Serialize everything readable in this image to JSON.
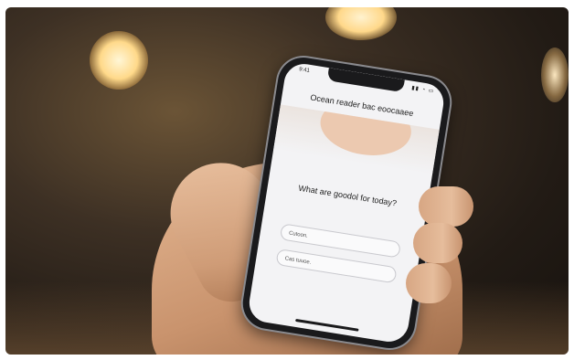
{
  "phone": {
    "status_time": "9:41",
    "status_icons": "▮▮ ◔ ▭",
    "header": "Ocean reader bac eoocaaee",
    "prompt": "What are goodol for today?",
    "fields": [
      {
        "placeholder": "Cutoon."
      },
      {
        "placeholder": "Cas tuuoe."
      }
    ]
  },
  "colors": {
    "background_dark": "#17120e",
    "bokeh_light": "#ffd98a",
    "screen": "#f3f3f5",
    "phone_body": "#1a1a1c",
    "skin": "#d7a683"
  }
}
